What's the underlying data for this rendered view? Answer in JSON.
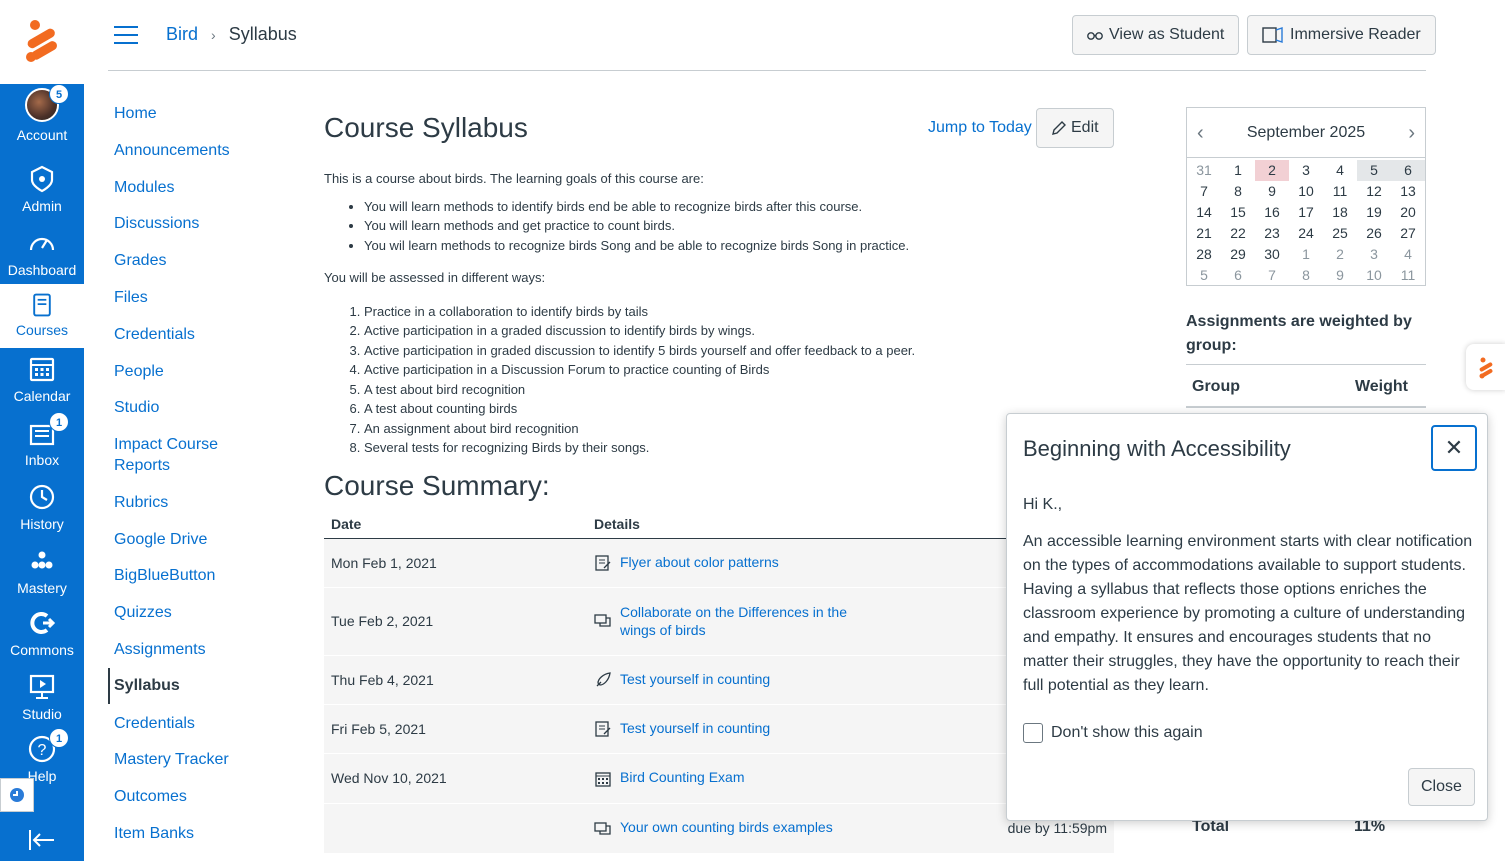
{
  "global_nav": {
    "items": [
      {
        "key": "account",
        "label": "Account",
        "icon": "avatar",
        "badge": "5"
      },
      {
        "key": "admin",
        "label": "Admin",
        "icon": "shield-icon"
      },
      {
        "key": "dashboard",
        "label": "Dashboard",
        "icon": "gauge-icon"
      },
      {
        "key": "courses",
        "label": "Courses",
        "icon": "book-icon"
      },
      {
        "key": "calendar",
        "label": "Calendar",
        "icon": "calendar-icon"
      },
      {
        "key": "inbox",
        "label": "Inbox",
        "icon": "inbox-icon",
        "badge": "1"
      },
      {
        "key": "history",
        "label": "History",
        "icon": "clock-icon"
      },
      {
        "key": "mastery",
        "label": "Mastery",
        "icon": "dots-icon"
      },
      {
        "key": "commons",
        "label": "Commons",
        "icon": "commons-icon"
      },
      {
        "key": "studio",
        "label": "Studio",
        "icon": "studio-icon"
      },
      {
        "key": "help",
        "label": "Help",
        "icon": "help-icon",
        "badge": "1"
      }
    ],
    "active_color": "#0770cf"
  },
  "header": {
    "breadcrumb": [
      "Bird",
      "Syllabus"
    ],
    "view_as_student": "View as Student",
    "immersive_reader": "Immersive Reader"
  },
  "course_nav": [
    "Home",
    "Announcements",
    "Modules",
    "Discussions",
    "Grades",
    "Files",
    "Credentials",
    "People",
    "Studio",
    "Impact Course Reports",
    "Rubrics",
    "Google Drive",
    "BigBlueButton",
    "Quizzes",
    "Assignments",
    "Syllabus",
    "Credentials",
    "Mastery Tracker",
    "Outcomes",
    "Item Banks"
  ],
  "main": {
    "title": "Course Syllabus",
    "jump_to_today": "Jump to Today",
    "edit": "Edit",
    "intro": "This is a course about birds.  The learning goals of this course are:",
    "goals": [
      "You will learn methods to identify birds end be able to recognize birds after this course.",
      "You will learn methods and get practice to count birds.",
      "You wil learn methods to recognize birds Song and be able to recognize birds Song in practice."
    ],
    "assessed_intro": "You will be assessed in different ways:",
    "assessments": [
      "Practice in a collaboration to identify birds by tails",
      "Active participation in a graded discussion to identify birds by wings.",
      "Active participation in graded discussion to identify 5 birds yourself and offer feedback to a peer.",
      "Active participation in a Discussion Forum to practice counting of Birds",
      "A test about bird recognition",
      "A test about counting birds",
      "An assignment about bird recognition",
      "Several tests for recognizing Birds by their songs."
    ],
    "summary_title": "Course Summary:",
    "table_headers": [
      "Date",
      "Details"
    ],
    "rows": [
      {
        "date": "Mon Feb 1, 2021",
        "icon": "assignment-icon",
        "title": "Flyer about color patterns",
        "due": ""
      },
      {
        "date": "Tue Feb 2, 2021",
        "icon": "discussion-icon",
        "title": "Collaborate on the Differences in the wings of birds",
        "due": ""
      },
      {
        "date": "Thu Feb 4, 2021",
        "icon": "quiz-icon",
        "title": "Test yourself in counting",
        "due": ""
      },
      {
        "date": "Fri Feb 5, 2021",
        "icon": "assignment-icon",
        "title": "Test yourself in counting",
        "due": ""
      },
      {
        "date": "Wed Nov 10, 2021",
        "icon": "calendar-event-icon",
        "title": "Bird Counting Exam",
        "due": ""
      },
      {
        "date": "",
        "icon": "discussion-icon",
        "title": "Your own counting birds examples",
        "due": "due by 11:59pm"
      }
    ]
  },
  "calendar": {
    "month": "September 2025",
    "days": [
      [
        "31",
        "dim"
      ],
      [
        "1",
        ""
      ],
      [
        "2",
        "today"
      ],
      [
        "3",
        ""
      ],
      [
        "4",
        ""
      ],
      [
        "5",
        "hl"
      ],
      [
        "6",
        "hl"
      ],
      [
        "7",
        ""
      ],
      [
        "8",
        ""
      ],
      [
        "9",
        ""
      ],
      [
        "10",
        ""
      ],
      [
        "11",
        ""
      ],
      [
        "12",
        ""
      ],
      [
        "13",
        ""
      ],
      [
        "14",
        ""
      ],
      [
        "15",
        ""
      ],
      [
        "16",
        ""
      ],
      [
        "17",
        ""
      ],
      [
        "18",
        ""
      ],
      [
        "19",
        ""
      ],
      [
        "20",
        ""
      ],
      [
        "21",
        ""
      ],
      [
        "22",
        ""
      ],
      [
        "23",
        ""
      ],
      [
        "24",
        ""
      ],
      [
        "25",
        ""
      ],
      [
        "26",
        ""
      ],
      [
        "27",
        ""
      ],
      [
        "28",
        ""
      ],
      [
        "29",
        ""
      ],
      [
        "30",
        ""
      ],
      [
        "1",
        "dim"
      ],
      [
        "2",
        "dim"
      ],
      [
        "3",
        "dim"
      ],
      [
        "4",
        "dim"
      ],
      [
        "5",
        "dim"
      ],
      [
        "6",
        "dim"
      ],
      [
        "7",
        "dim"
      ],
      [
        "8",
        "dim"
      ],
      [
        "9",
        "dim"
      ],
      [
        "10",
        "dim"
      ],
      [
        "11",
        "dim"
      ]
    ]
  },
  "weights": {
    "title": "Assignments are weighted by group:",
    "col_group": "Group",
    "col_weight": "Weight",
    "total_label": "Total",
    "total_value": "11%"
  },
  "modal": {
    "title": "Beginning with Accessibility",
    "greeting": "Hi K.,",
    "body": "An accessible learning environment starts with clear notification on the types of accommodations available to support students. Having a syllabus that reflects those options enriches the classroom experience by promoting a culture of understanding and empathy. It ensures and encourages students that no matter their struggles, they have the opportunity to reach their full potential as they learn.",
    "checkbox_label": "Don't show this again",
    "close": "Close"
  }
}
